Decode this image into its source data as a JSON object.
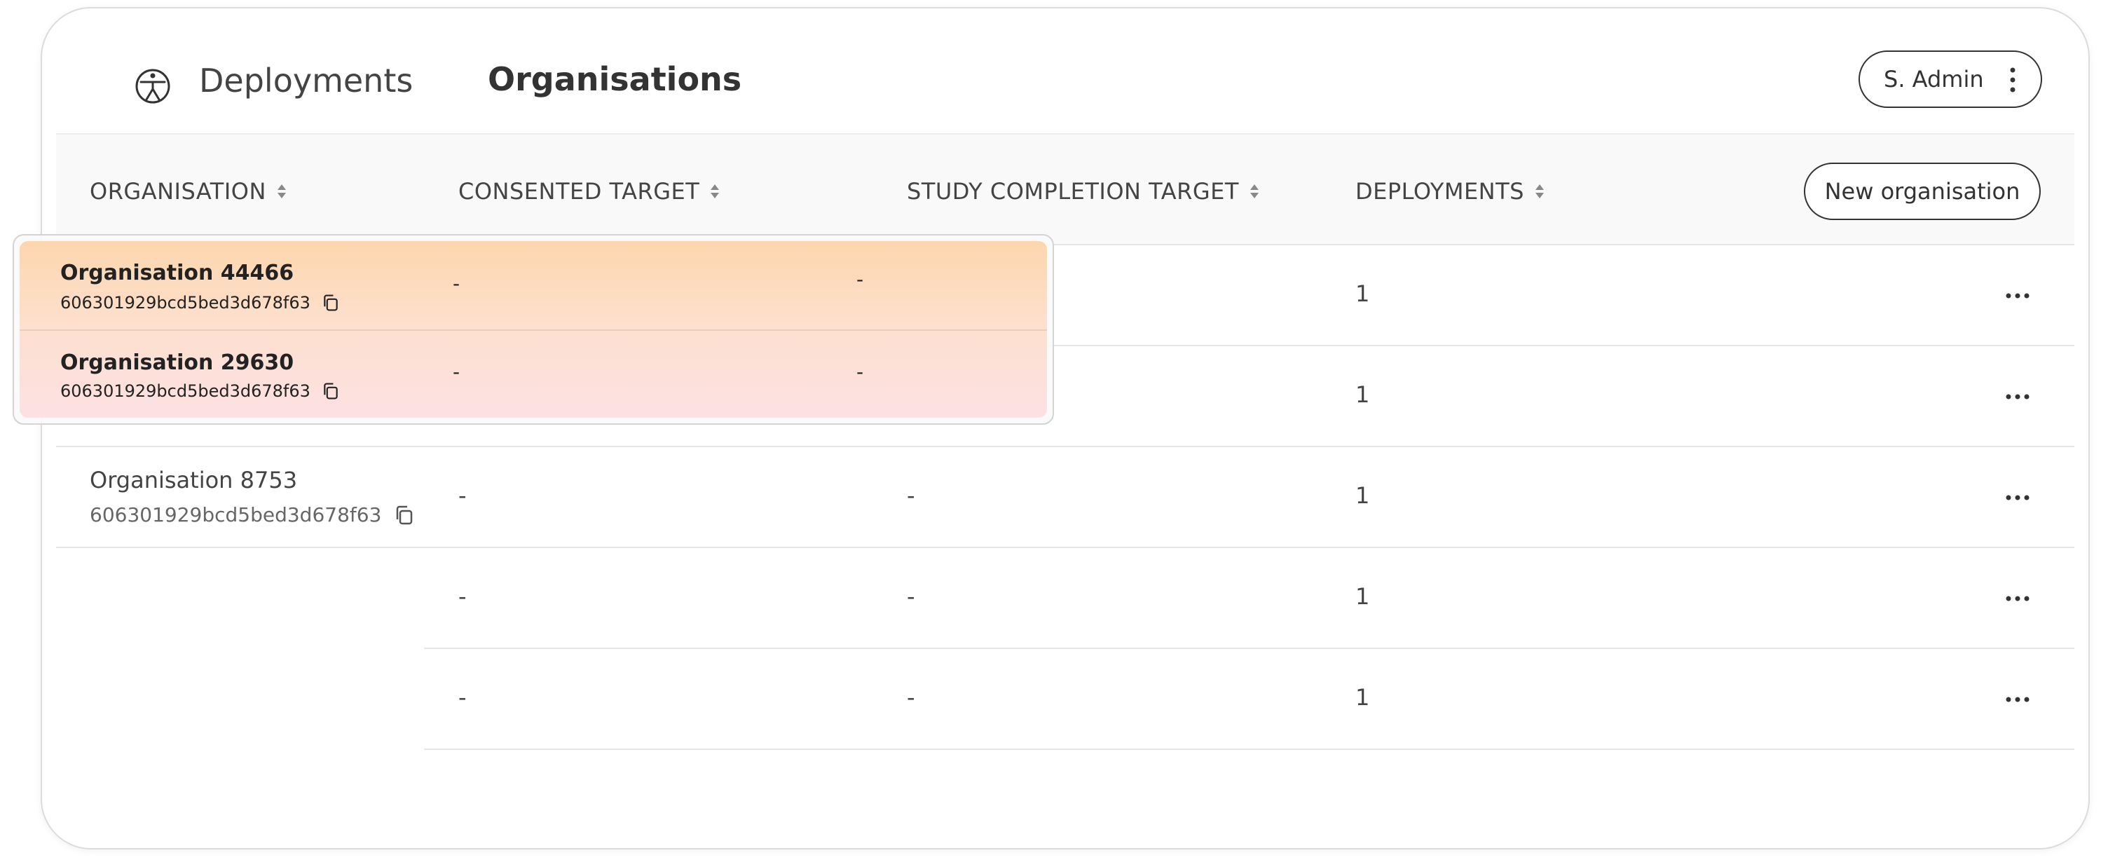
{
  "nav": {
    "tabs": [
      {
        "label": "Deployments"
      },
      {
        "label": "Organisations"
      }
    ],
    "active_tab": "Organisations",
    "user_label": "S. Admin"
  },
  "table": {
    "columns": [
      {
        "label": "ORGANISATION"
      },
      {
        "label": "CONSENTED TARGET"
      },
      {
        "label": "STUDY COMPLETION TARGET"
      },
      {
        "label": "DEPLOYMENTS"
      }
    ],
    "new_button_label": "New organisation",
    "rows": [
      {
        "name": "",
        "id": "",
        "consented": "",
        "completion": "",
        "deployments": "1"
      },
      {
        "name": "",
        "id": "",
        "consented": "",
        "completion": "",
        "deployments": "1"
      },
      {
        "name": "Organisation 8753",
        "id": "606301929bcd5bed3d678f63",
        "consented": "-",
        "completion": "-",
        "deployments": "1"
      },
      {
        "name": "",
        "id": "",
        "consented": "-",
        "completion": "-",
        "deployments": "1"
      },
      {
        "name": "",
        "id": "",
        "consented": "-",
        "completion": "-",
        "deployments": "1"
      }
    ]
  },
  "drag_preview": {
    "rows": [
      {
        "name": "Organisation 44466",
        "id": "606301929bcd5bed3d678f63",
        "consented": "-",
        "completion": "-"
      },
      {
        "name": "Organisation 29630",
        "id": "606301929bcd5bed3d678f63",
        "consented": "-",
        "completion": "-"
      }
    ],
    "colors": {
      "gradient_top": "#fdd6ae",
      "gradient_bottom": "#fde1e3"
    }
  },
  "icons": {
    "logo": "accessibility-person-icon",
    "sort": "sort-arrows-icon",
    "copy": "copy-icon",
    "row_menu": "more-horizontal-icon",
    "user_menu": "more-vertical-icon"
  }
}
